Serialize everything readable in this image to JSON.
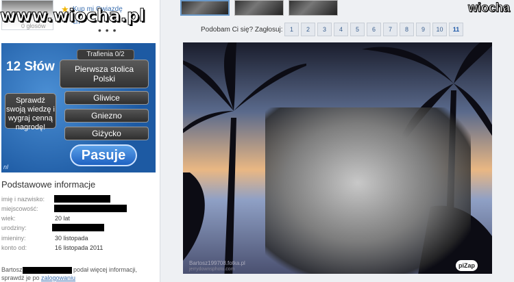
{
  "header": {
    "buy_link": "Kup mi Gwiazdę",
    "buy_link_2": "ch",
    "votes_text": "0 głosów",
    "more": "• • •"
  },
  "watermark": {
    "main": "www.wiocha.pl",
    "corner": "wiocha"
  },
  "ad": {
    "title": "12 Słów",
    "hits": "Trafienia 0/2",
    "question": "Pierwsza stolica Polski",
    "promo": "Sprawdź swoją wiedzę i wygraj cenną nagrodę!",
    "options": [
      "Gliwice",
      "Gniezno",
      "Giżycko"
    ],
    "pass": "Pasuje",
    "logo": "nl"
  },
  "info": {
    "title": "Podstawowe informacje",
    "rows": [
      {
        "label": "imię i nazwisko:",
        "value": ""
      },
      {
        "label": "miejscowość:",
        "value": ""
      },
      {
        "label": "wiek:",
        "value": "20 lat"
      },
      {
        "label": "urodziny:",
        "value": ""
      },
      {
        "label": "imieniny:",
        "value": "30 listopada"
      },
      {
        "label": "konto od:",
        "value": "16 listopada 2011"
      }
    ],
    "bio_start": "Bartosz",
    "bio_end": " podał więcej informacji,",
    "bio_line2": "sprawdź je po ",
    "bio_link": "zalogowaniu"
  },
  "voting": {
    "label": "Podobam Ci się? Zagłosuj:",
    "options": [
      "1",
      "2",
      "3",
      "4",
      "5",
      "6",
      "7",
      "8",
      "9",
      "10",
      "11"
    ]
  },
  "photo": {
    "watermark_line1": "Bartosz199708.fotka.pl",
    "watermark_line2": "jerrydownsphoto.com",
    "badge": "piZap"
  }
}
